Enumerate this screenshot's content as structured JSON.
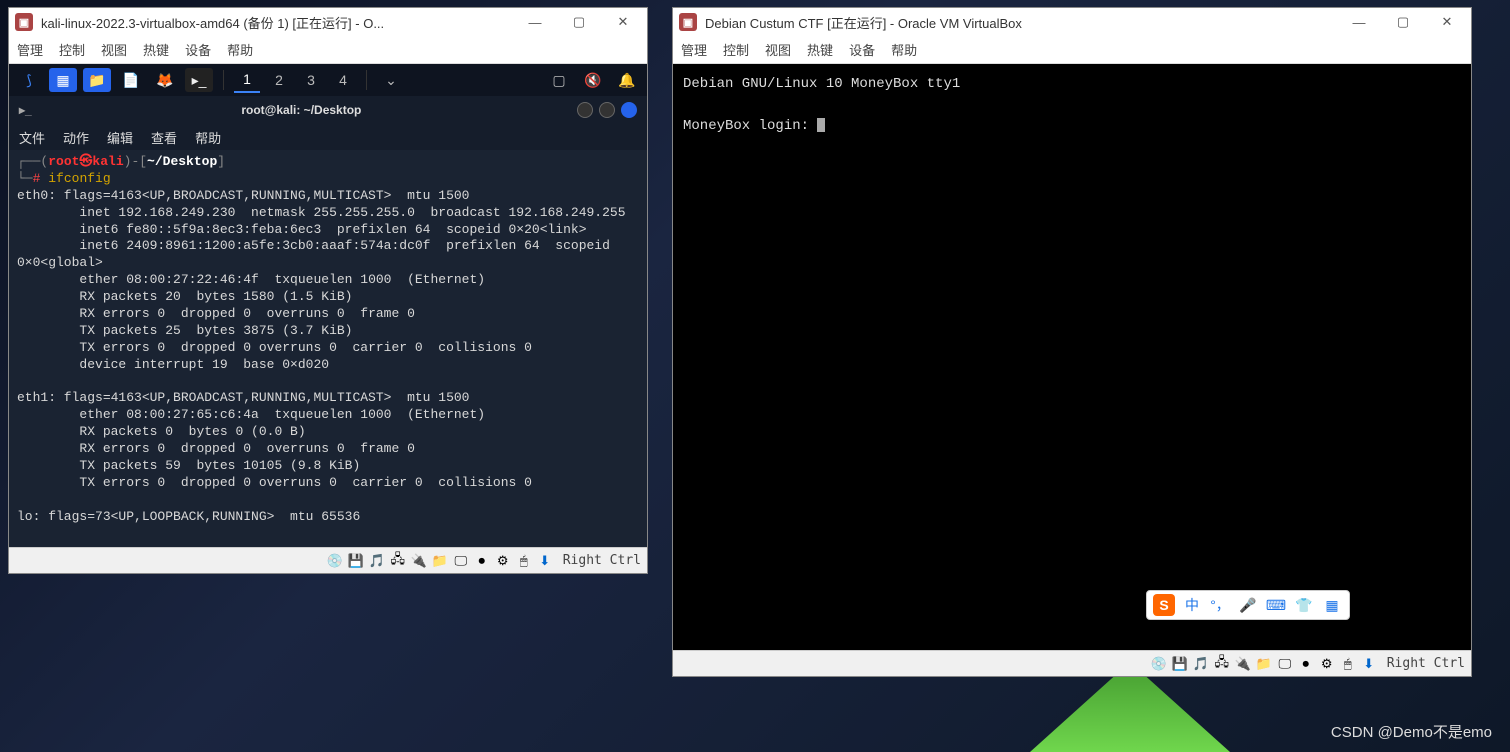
{
  "left_vm": {
    "title": "kali-linux-2022.3-virtualbox-amd64 (备份 1) [正在运行] - O...",
    "menubar": [
      "管理",
      "控制",
      "视图",
      "热键",
      "设备",
      "帮助"
    ],
    "workspaces": [
      "1",
      "2",
      "3",
      "4"
    ],
    "terminal": {
      "title": "root@kali: ~/Desktop",
      "menubar": [
        "文件",
        "动作",
        "编辑",
        "查看",
        "帮助"
      ],
      "prompt_user": "root㉿kali",
      "prompt_path": "~/Desktop",
      "command": "ifconfig",
      "output": "eth0: flags=4163<UP,BROADCAST,RUNNING,MULTICAST>  mtu 1500\n        inet 192.168.249.230  netmask 255.255.255.0  broadcast 192.168.249.255\n        inet6 fe80::5f9a:8ec3:feba:6ec3  prefixlen 64  scopeid 0×20<link>\n        inet6 2409:8961:1200:a5fe:3cb0:aaaf:574a:dc0f  prefixlen 64  scopeid 0×0<global>\n        ether 08:00:27:22:46:4f  txqueuelen 1000  (Ethernet)\n        RX packets 20  bytes 1580 (1.5 KiB)\n        RX errors 0  dropped 0  overruns 0  frame 0\n        TX packets 25  bytes 3875 (3.7 KiB)\n        TX errors 0  dropped 0 overruns 0  carrier 0  collisions 0\n        device interrupt 19  base 0×d020\n\neth1: flags=4163<UP,BROADCAST,RUNNING,MULTICAST>  mtu 1500\n        ether 08:00:27:65:c6:4a  txqueuelen 1000  (Ethernet)\n        RX packets 0  bytes 0 (0.0 B)\n        RX errors 0  dropped 0  overruns 0  frame 0\n        TX packets 59  bytes 10105 (9.8 KiB)\n        TX errors 0  dropped 0 overruns 0  carrier 0  collisions 0\n\nlo: flags=73<UP,LOOPBACK,RUNNING>  mtu 65536"
    },
    "statusbar_label": "Right Ctrl"
  },
  "right_vm": {
    "title": "Debian Custum CTF [正在运行] - Oracle VM VirtualBox",
    "menubar": [
      "管理",
      "控制",
      "视图",
      "热键",
      "设备",
      "帮助"
    ],
    "console_line1": "Debian GNU/Linux 10 MoneyBox tty1",
    "console_line2": "MoneyBox login: ",
    "statusbar_label": "Right Ctrl"
  },
  "ime": {
    "logo": "S",
    "lang": "中"
  },
  "watermark": "CSDN @Demo不是emo"
}
